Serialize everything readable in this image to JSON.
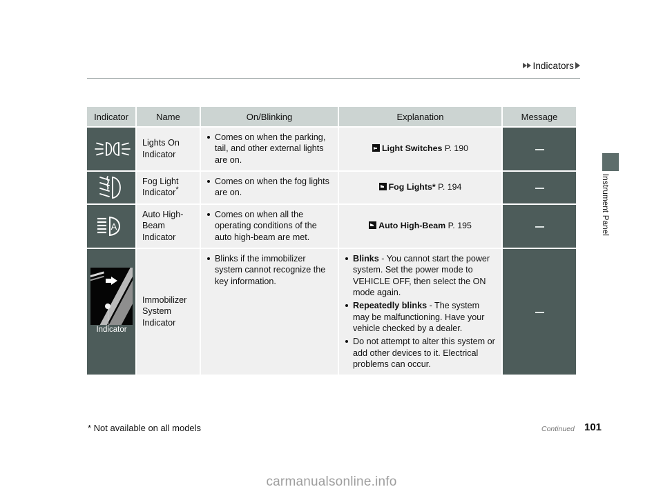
{
  "header": {
    "breadcrumb_label": "Indicators",
    "side_tab_label": "Instrument Panel"
  },
  "table": {
    "columns": [
      "Indicator",
      "Name",
      "On/Blinking",
      "Explanation",
      "Message"
    ],
    "rows": [
      {
        "icon": "lights-on-indicator-icon",
        "name": "Lights On Indicator",
        "name_line1": "Lights On",
        "name_line2": "Indicator",
        "on_blinking": [
          "Comes on when the parking, tail, and other external lights are on."
        ],
        "explanation_ref": {
          "label": "Light Switches",
          "page": "P. 190"
        },
        "message": "—"
      },
      {
        "icon": "fog-light-indicator-icon",
        "name": "Fog Light Indicator*",
        "name_line1": "Fog Light",
        "name_line2": "Indicator",
        "name_asterisk": "*",
        "on_blinking": [
          "Comes on when the fog lights are on."
        ],
        "explanation_ref": {
          "label": "Fog Lights*",
          "page": "P. 194"
        },
        "message": "—"
      },
      {
        "icon": "auto-high-beam-indicator-icon",
        "name": "Auto High-Beam Indicator",
        "name_line1": "Auto High-Beam",
        "name_line2": "Indicator",
        "on_blinking": [
          "Comes on when all the operating conditions of the auto high-beam are met."
        ],
        "explanation_ref": {
          "label": "Auto High-Beam",
          "page": "P. 195"
        },
        "message": "—"
      },
      {
        "icon": "immobilizer-system-photo",
        "photo_caption": "Indicator",
        "name": "Immobilizer System Indicator",
        "name_line1": "Immobilizer",
        "name_line2": "System Indicator",
        "on_blinking": [
          "Blinks if the immobilizer system cannot recognize the key information."
        ],
        "explanation_bullets": [
          {
            "bold": "Blinks",
            "text": " - You cannot start the power system. Set the power mode to VEHICLE OFF, then select the ON mode again."
          },
          {
            "bold": "Repeatedly blinks",
            "text": " - The system may be malfunctioning. Have your vehicle checked by a dealer."
          },
          {
            "bold": "",
            "text": "Do not attempt to alter this system or add other devices to it. Electrical problems can occur."
          }
        ],
        "message": "—"
      }
    ]
  },
  "footer": {
    "footnote": "*  Not available on all models",
    "continued": "Continued",
    "page_number": "101",
    "watermark": "carmanualsonline.info"
  },
  "colors": {
    "header_fill": "#ccd4d2",
    "dark_cell": "#4d5c5a",
    "body_cell": "#f0f0f0"
  }
}
